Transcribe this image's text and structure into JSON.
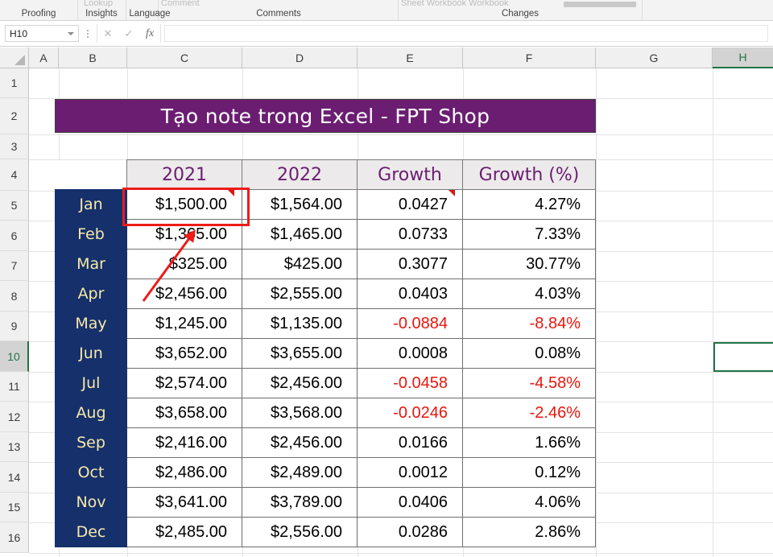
{
  "ribbon": {
    "groups": [
      {
        "label": "Proofing"
      },
      {
        "label": "Insights"
      },
      {
        "label": "Language"
      },
      {
        "label": "Comments"
      },
      {
        "label": "Changes"
      }
    ],
    "ghost_labels": [
      {
        "label": "Lookup"
      },
      {
        "label": "Comment"
      },
      {
        "label": "Sheet  Workbook  Workbook"
      }
    ]
  },
  "formula_bar": {
    "name_box_value": "H10",
    "cancel_icon": "close-icon",
    "enter_icon": "check-icon",
    "function_icon": "fx-icon",
    "formula_value": "",
    "formula_placeholder": ""
  },
  "grid": {
    "column_headers": [
      "A",
      "B",
      "C",
      "D",
      "E",
      "F",
      "G",
      "H"
    ],
    "selected_column": "H",
    "row_headers": [
      "1",
      "2",
      "3",
      "4",
      "5",
      "6",
      "7",
      "8",
      "9",
      "10",
      "11",
      "12",
      "13",
      "14",
      "15",
      "16"
    ],
    "selected_row": "10",
    "active_cell": "H10"
  },
  "title_banner": {
    "text": "Tạo note trong Excel - FPT Shop",
    "background": "#6b1d72",
    "text_color": "#ffffff"
  },
  "table": {
    "headers": [
      "2021",
      "2022",
      "Growth",
      "Growth (%)"
    ],
    "header_text_color": "#6b1d72",
    "header_background": "#eceaea",
    "month_background": "#15306b",
    "month_text_color": "#f7e9a8",
    "negative_color": "#e8160c",
    "rows": [
      {
        "month": "Jan",
        "y2021": "$1,500.00",
        "y2022": "$1,564.00",
        "growth": "0.0427",
        "growth_pct": "4.27%",
        "negative": false,
        "note_2021": true,
        "note_growth": true
      },
      {
        "month": "Feb",
        "y2021": "$1,365.00",
        "y2022": "$1,465.00",
        "growth": "0.0733",
        "growth_pct": "7.33%",
        "negative": false,
        "note_2021": false,
        "note_growth": false
      },
      {
        "month": "Mar",
        "y2021": "$325.00",
        "y2022": "$425.00",
        "growth": "0.3077",
        "growth_pct": "30.77%",
        "negative": false,
        "note_2021": false,
        "note_growth": false
      },
      {
        "month": "Apr",
        "y2021": "$2,456.00",
        "y2022": "$2,555.00",
        "growth": "0.0403",
        "growth_pct": "4.03%",
        "negative": false,
        "note_2021": false,
        "note_growth": false
      },
      {
        "month": "May",
        "y2021": "$1,245.00",
        "y2022": "$1,135.00",
        "growth": "-0.0884",
        "growth_pct": "-8.84%",
        "negative": true,
        "note_2021": false,
        "note_growth": false
      },
      {
        "month": "Jun",
        "y2021": "$3,652.00",
        "y2022": "$3,655.00",
        "growth": "0.0008",
        "growth_pct": "0.08%",
        "negative": false,
        "note_2021": false,
        "note_growth": false
      },
      {
        "month": "Jul",
        "y2021": "$2,574.00",
        "y2022": "$2,456.00",
        "growth": "-0.0458",
        "growth_pct": "-4.58%",
        "negative": true,
        "note_2021": false,
        "note_growth": false
      },
      {
        "month": "Aug",
        "y2021": "$3,658.00",
        "y2022": "$3,568.00",
        "growth": "-0.0246",
        "growth_pct": "-2.46%",
        "negative": true,
        "note_2021": false,
        "note_growth": false
      },
      {
        "month": "Sep",
        "y2021": "$2,416.00",
        "y2022": "$2,456.00",
        "growth": "0.0166",
        "growth_pct": "1.66%",
        "negative": false,
        "note_2021": false,
        "note_growth": false
      },
      {
        "month": "Oct",
        "y2021": "$2,486.00",
        "y2022": "$2,489.00",
        "growth": "0.0012",
        "growth_pct": "0.12%",
        "negative": false,
        "note_2021": false,
        "note_growth": false
      },
      {
        "month": "Nov",
        "y2021": "$3,641.00",
        "y2022": "$3,789.00",
        "growth": "0.0406",
        "growth_pct": "4.06%",
        "negative": false,
        "note_2021": false,
        "note_growth": false
      },
      {
        "month": "Dec",
        "y2021": "$2,485.00",
        "y2022": "$2,556.00",
        "growth": "0.0286",
        "growth_pct": "2.86%",
        "negative": false,
        "note_2021": false,
        "note_growth": false
      }
    ]
  },
  "annotations": {
    "highlight_color": "#ee1b17",
    "highlight_target_cell": "C5",
    "arrow_color": "#ee1b17"
  }
}
